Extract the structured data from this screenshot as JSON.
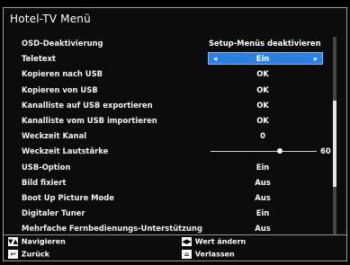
{
  "menu": {
    "title": "Hotel-TV Menü",
    "rows": [
      {
        "label": "OSD-Deaktivierung",
        "value": "Setup-Menüs deaktivieren"
      },
      {
        "label": "Teletext",
        "value": "Ein"
      },
      {
        "label": "Kopieren nach USB",
        "value": "OK"
      },
      {
        "label": "Kopieren von USB",
        "value": "OK"
      },
      {
        "label": "Kanalliste auf USB exportieren",
        "value": "OK"
      },
      {
        "label": "Kanalliste vom USB importieren",
        "value": "OK"
      },
      {
        "label": "Weckzeit Kanal",
        "value": "0"
      },
      {
        "label": "Weckzeit Lautstärke",
        "value": "60"
      },
      {
        "label": "USB-Option",
        "value": "Ein"
      },
      {
        "label": "Bild fixiert",
        "value": "Aus"
      },
      {
        "label": "Boot Up Picture Mode",
        "value": "Aus"
      },
      {
        "label": "Digitaler Tuner",
        "value": "Ein"
      },
      {
        "label": "Mehrfache Fernbedienungs-Unterstützung",
        "value": "Aus"
      }
    ]
  },
  "footer": {
    "navigate": "Navigieren",
    "back": "Zurück",
    "change_value": "Wert ändern",
    "exit": "Verlassen"
  },
  "volume": {
    "level_fraction": 0.65
  }
}
